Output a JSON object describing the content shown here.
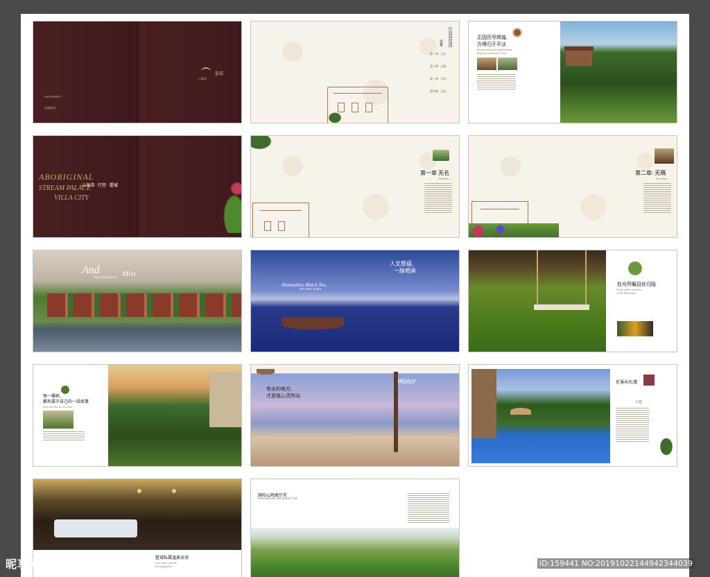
{
  "brochure": {
    "row1": {
      "cover_logo_left": "山海湾",
      "cover_logo_right": "聖城",
      "cover_tel": "0898-88888877",
      "cover_addr": "全城热线",
      "toc_title": "content",
      "toc_title_cn": "目录",
      "toc_items": [
        "第一章 · 无名",
        "第二章 · 无隅",
        "第三章 · 无形",
        "第四章 · 无成"
      ],
      "intro_heading_1": "正因历尽辉煌,",
      "intro_heading_2": "方得归于平淡",
      "intro_sub_1": "Because going through brilliant,",
      "intro_sub_2": "Pang was attributed to flat"
    },
    "row2": {
      "title_cn": "山海湾 · 行宫 · 墅城",
      "title_en_1": "ABORIGINAL",
      "title_en_2": "STREAM PALACE",
      "title_en_3": "VILLA CITY",
      "chapter1": "第一章 无名",
      "chapter1_en": "Nameless",
      "chapter2": "第二章: 无隅",
      "chapter2_en": "No corner"
    },
    "row3": {
      "lake_script": "And",
      "lake_sub_1": "Ocean Beauty & the",
      "lake_sub_2": "Mist",
      "boat_heading_1": "人文厚蕴,",
      "boat_heading_2": "一脉相承",
      "boat_script": "Humanities Match You,",
      "boat_script_2": "the same origin",
      "swing_heading": "在众所瞩目处归隐",
      "swing_en_1": "In the public attention",
      "swing_en_2": "at the Hermitage"
    },
    "row4": {
      "tree_heading_1": "每一棵树,",
      "tree_heading_2": "都有属于自己的一段故事",
      "tree_en": "Each tree has its own story",
      "beach_heading_1": "有水的地方,",
      "beach_heading_2": "才是我心灵所向.",
      "beach_en": "Water",
      "pool_heading": "在溪水间,看",
      "pool_sub": "三亚"
    },
    "row5": {
      "spa_heading": "墅城私属温泉泳池",
      "spa_en_1": "City villa is private",
      "spa_en_2": "hot spring pool",
      "golf_heading": "国际山地高尔夫",
      "golf_en": "International Mountain Golf"
    }
  },
  "watermark": {
    "left": "昵享网",
    "left_url": "www.nipic.com",
    "right": "ID:159441 NO:20191022144942344039"
  },
  "colors": {
    "background": "#4a4a4a",
    "maroon": "#4a1f22",
    "cream": "#f7f2ea",
    "gold": "#c9a86a"
  }
}
